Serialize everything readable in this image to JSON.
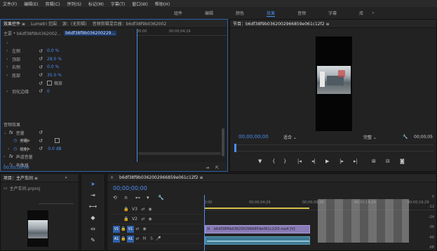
{
  "menu": [
    "文件(F)",
    "编辑(E)",
    "剪辑(C)",
    "序列(S)",
    "标记(M)",
    "字幕(T)",
    "窗口(W)",
    "帮助(H)"
  ],
  "workspaces": {
    "items": [
      "组件",
      "编辑",
      "颜色",
      "效果",
      "音频",
      "字幕",
      "库"
    ],
    "active_index": 3,
    "more": "»"
  },
  "effect_controls": {
    "tabs": [
      "效果控件 ≡",
      "Lumetri 范围",
      "源：(无剪辑)",
      "音频剪辑混合器：b6df38f9b0362002"
    ],
    "master_label": "主要 * b6df38f9b0362002...",
    "clip_label": "b6df38f9b036200229...",
    "rows": [
      {
        "caret": "›",
        "label": "左侧",
        "value": "0.0 %"
      },
      {
        "caret": "›",
        "label": "顶部",
        "value": "28.0 %"
      },
      {
        "caret": "›",
        "label": "右侧",
        "value": "0.0 %"
      },
      {
        "caret": "›",
        "label": "底部",
        "value": "35.0 %"
      },
      {
        "caret": "",
        "label": "",
        "value": "",
        "checkbox_label": "缩放"
      },
      {
        "caret": "›",
        "label": "羽化边缘",
        "value": "0"
      }
    ],
    "audio_effects_label": "音频效果",
    "volume": {
      "fx": "fx",
      "label": "音量"
    },
    "bypass": {
      "label": "旁路"
    },
    "level": {
      "label": "级别",
      "value": "0.0 dB"
    },
    "channel_volume": {
      "fx": "fx",
      "label": "声道音量"
    },
    "panner": {
      "fx": "fx",
      "label": "声像器"
    },
    "ruler": {
      "start": "00:00",
      "mid": "00:00;04;29"
    },
    "timecode": "00;00;00;00"
  },
  "program": {
    "title": "节目：b6df38f9b0362002966859e061c12f2 ≡",
    "timecode_left": "00;00;00;00",
    "fit": "适合",
    "quality": "完整",
    "timecode_right": "00;00;05"
  },
  "project": {
    "tab": "项目：主产车间 ≡",
    "file": "主产车间.prproj"
  },
  "timeline": {
    "tab": "b6df38f9b0362002966859e061c12f2 ≡",
    "timecode": "00;00;00;00",
    "ruler": [
      "0;00",
      "00;00;04;29",
      "00;00;09;29",
      "00;00;14;29",
      "00;00;19;29"
    ],
    "tracks": [
      {
        "name": "V3"
      },
      {
        "name": "V2"
      },
      {
        "name": "V1",
        "active": true
      },
      {
        "name": "A1",
        "active": true
      }
    ],
    "clip_label": "b6df38f9b0362002966859e061c12f2.mp4 [V]",
    "db_labels": [
      "0",
      "-12",
      "-24",
      "-36",
      "-48",
      "dB"
    ]
  }
}
